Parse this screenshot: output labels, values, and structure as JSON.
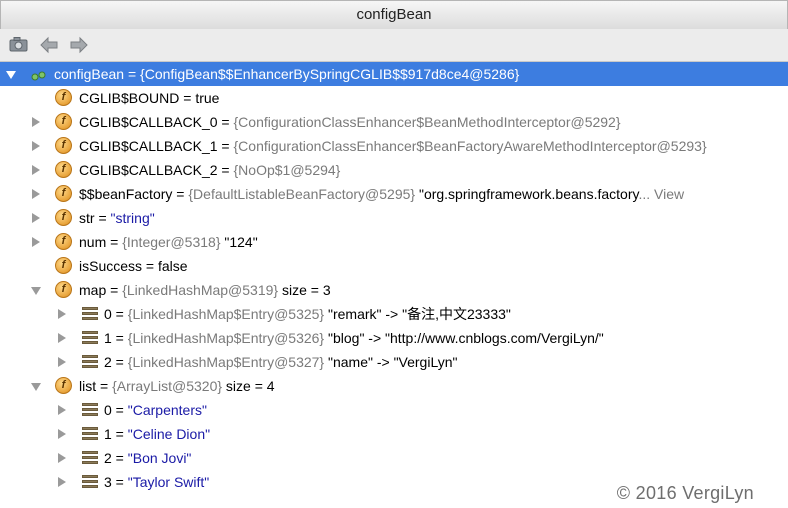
{
  "window": {
    "title": "configBean"
  },
  "toolbar": {
    "icons": [
      "camera-icon",
      "back-arrow-icon",
      "forward-arrow-icon"
    ]
  },
  "tree": {
    "root": {
      "name": "configBean",
      "eq": " = ",
      "value": "{ConfigBean$$EnhancerBySpringCGLIB$$917d8ce4@5286}"
    },
    "fields": [
      {
        "name": "CGLIB$BOUND",
        "eq": " = ",
        "ref": "",
        "value": "true"
      },
      {
        "name": "CGLIB$CALLBACK_0",
        "eq": " = ",
        "ref": "{ConfigurationClassEnhancer$BeanMethodInterceptor@5292}",
        "value": ""
      },
      {
        "name": "CGLIB$CALLBACK_1",
        "eq": " = ",
        "ref": "{ConfigurationClassEnhancer$BeanFactoryAwareMethodInterceptor@5293}",
        "value": ""
      },
      {
        "name": "CGLIB$CALLBACK_2",
        "eq": " = ",
        "ref": "{NoOp$1@5294}",
        "value": ""
      },
      {
        "name": "$$beanFactory",
        "eq": " = ",
        "ref": "{DefaultListableBeanFactory@5295}",
        "value": " \"org.springframework.beans.factory",
        "more": "... View"
      },
      {
        "name": "str",
        "eq": " = ",
        "ref": "",
        "value": "\"string\""
      },
      {
        "name": "num",
        "eq": " = ",
        "ref": "{Integer@5318}",
        "value": " \"124\""
      },
      {
        "name": "isSuccess",
        "eq": " = ",
        "ref": "",
        "value": "false"
      },
      {
        "name": "map",
        "eq": " = ",
        "ref": "{LinkedHashMap@5319}",
        "value": "  size = 3"
      }
    ],
    "map_entries": [
      {
        "index": "0",
        "eq": " = ",
        "ref": "{LinkedHashMap$Entry@5325}",
        "value": " \"remark\" -> \"备注,中文23333\""
      },
      {
        "index": "1",
        "eq": " = ",
        "ref": "{LinkedHashMap$Entry@5326}",
        "value": " \"blog\" -> \"http://www.cnblogs.com/VergiLyn/\""
      },
      {
        "index": "2",
        "eq": " = ",
        "ref": "{LinkedHashMap$Entry@5327}",
        "value": " \"name\" -> \"VergiLyn\""
      }
    ],
    "list": {
      "name": "list",
      "eq": " = ",
      "ref": "{ArrayList@5320}",
      "value": "  size = 4"
    },
    "list_entries": [
      {
        "index": "0",
        "eq": " = ",
        "value": "\"Carpenters\""
      },
      {
        "index": "1",
        "eq": " = ",
        "value": "\"Celine Dion\""
      },
      {
        "index": "2",
        "eq": " = ",
        "value": "\"Bon Jovi\""
      },
      {
        "index": "3",
        "eq": " = ",
        "value": "\"Taylor Swift\""
      }
    ]
  },
  "watermark": "© 2016 VergiLyn",
  "colors": {
    "selection": "#3d7de0",
    "string_value": "#1a1aa6",
    "ref_value": "#7a7a7a"
  }
}
